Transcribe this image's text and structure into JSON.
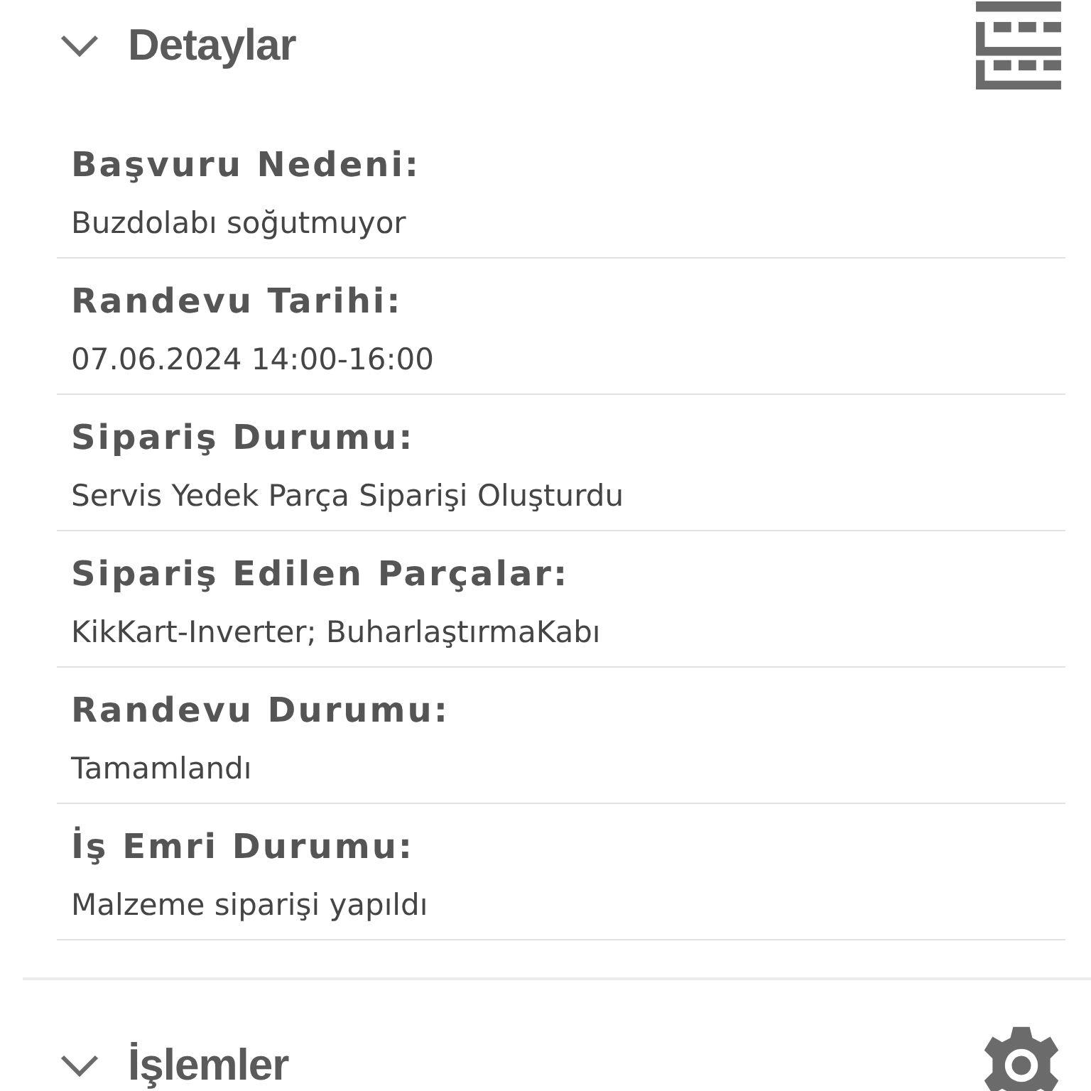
{
  "sections": [
    {
      "title": "Detaylar",
      "kind": "table",
      "fields": [
        {
          "label": "Başvuru Nedeni:",
          "value": "Buzdolabı soğutmuyor"
        },
        {
          "label": "Randevu Tarihi:",
          "value": "07.06.2024 14:00-16:00"
        },
        {
          "label": "Sipariş Durumu:",
          "value": "Servis Yedek Parça Siparişi Oluşturdu"
        },
        {
          "label": "Sipariş Edilen Parçalar:",
          "value": "KikKart-Inverter; BuharlaştırmaKabı"
        },
        {
          "label": "Randevu Durumu:",
          "value": "Tamamlandı"
        },
        {
          "label": "İş Emri Durumu:",
          "value": "Malzeme siparişi yapıldı"
        }
      ]
    },
    {
      "title": "İşlemler",
      "kind": "settings"
    }
  ]
}
